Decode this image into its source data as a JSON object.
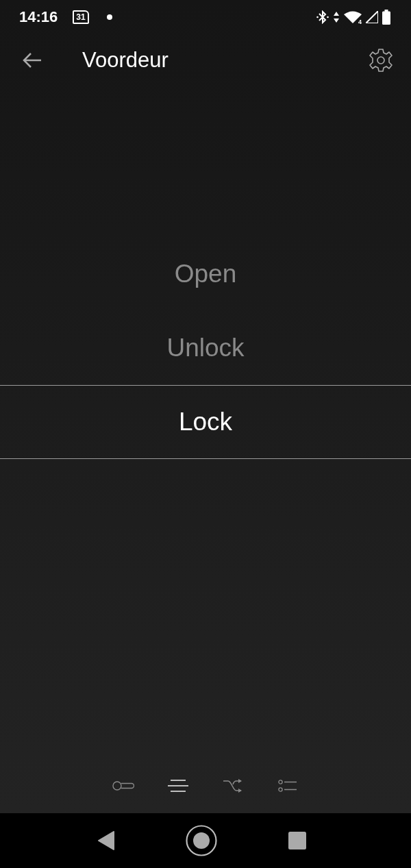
{
  "status_bar": {
    "time": "14:16",
    "calendar_day": "31",
    "network_badge": "4"
  },
  "toolbar": {
    "title": "Voordeur"
  },
  "picker": {
    "options": [
      {
        "label": "Open",
        "selected": false
      },
      {
        "label": "Unlock",
        "selected": false
      },
      {
        "label": "Lock",
        "selected": true
      }
    ]
  },
  "bottom_tabs": [
    {
      "kind": "toggle",
      "selected": false
    },
    {
      "kind": "lines",
      "selected": true
    },
    {
      "kind": "shuffle",
      "selected": false
    },
    {
      "kind": "list",
      "selected": false
    }
  ]
}
